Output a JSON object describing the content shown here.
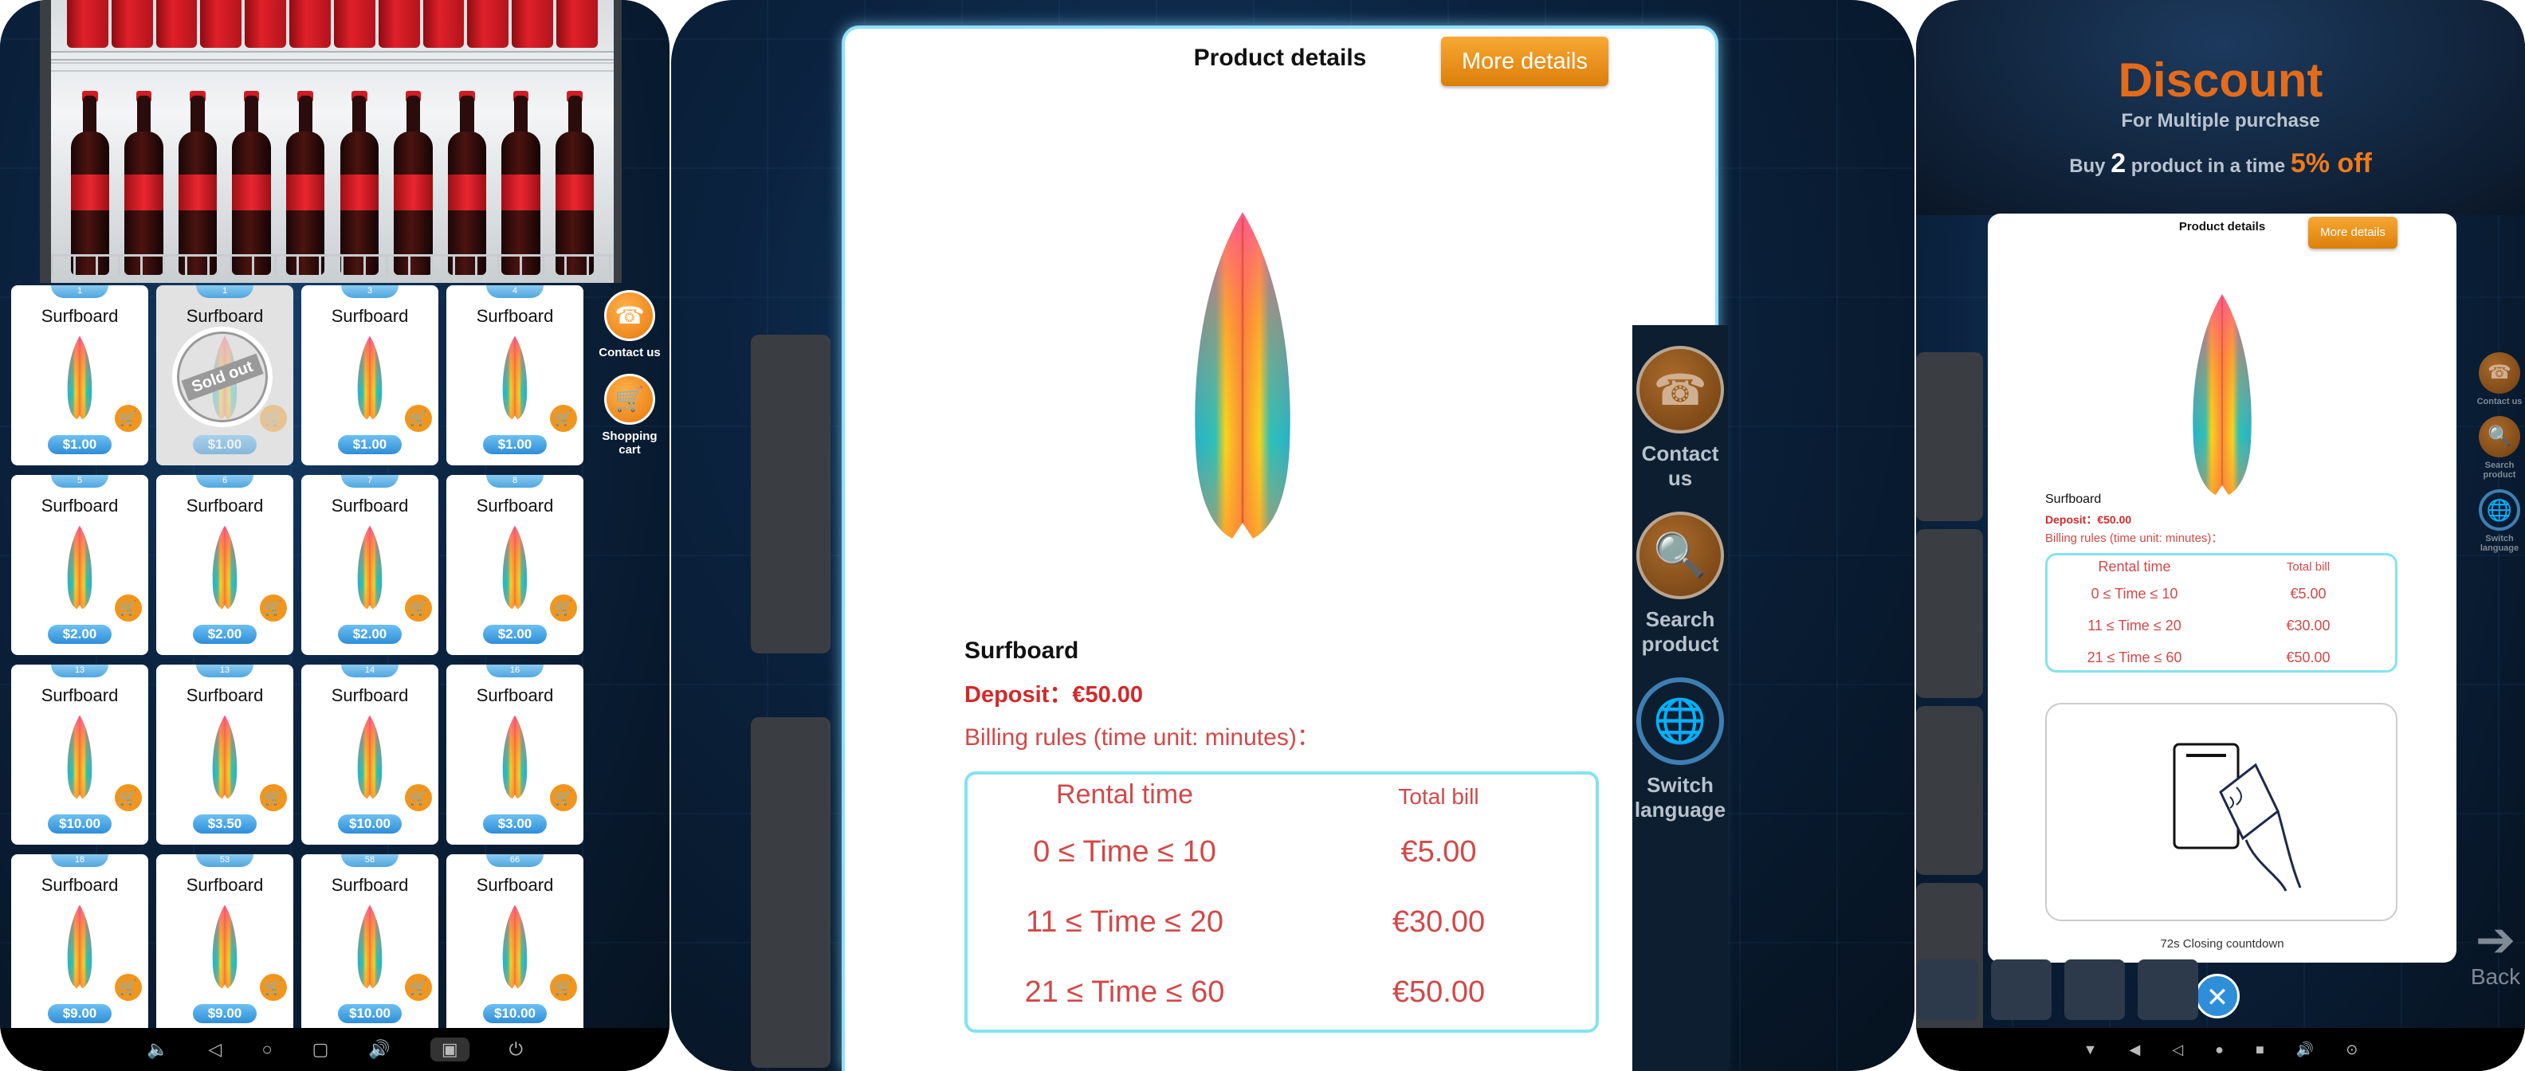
{
  "panel1": {
    "products": [
      {
        "num": "1",
        "name": "Surfboard",
        "price": "$1.00"
      },
      {
        "num": "1",
        "name": "Surfboard",
        "price": "$1.00",
        "sold": "Sold out"
      },
      {
        "num": "3",
        "name": "Surfboard",
        "price": "$1.00"
      },
      {
        "num": "4",
        "name": "Surfboard",
        "price": "$1.00"
      },
      {
        "num": "5",
        "name": "Surfboard",
        "price": "$2.00"
      },
      {
        "num": "6",
        "name": "Surfboard",
        "price": "$2.00"
      },
      {
        "num": "7",
        "name": "Surfboard",
        "price": "$2.00"
      },
      {
        "num": "8",
        "name": "Surfboard",
        "price": "$2.00"
      },
      {
        "num": "13",
        "name": "Surfboard",
        "price": "$10.00"
      },
      {
        "num": "13",
        "name": "Surfboard",
        "price": "$3.50"
      },
      {
        "num": "14",
        "name": "Surfboard",
        "price": "$10.00"
      },
      {
        "num": "16",
        "name": "Surfboard",
        "price": "$3.00"
      },
      {
        "num": "18",
        "name": "Surfboard",
        "price": "$9.00"
      },
      {
        "num": "53",
        "name": "Surfboard",
        "price": "$9.00"
      },
      {
        "num": "58",
        "name": "Surfboard",
        "price": "$10.00"
      },
      {
        "num": "66",
        "name": "Surfboard",
        "price": "$10.00"
      }
    ],
    "side": {
      "contact": "Contact us",
      "cart": "Shopping cart"
    }
  },
  "panel2": {
    "title": "Product details",
    "more": "More details",
    "product": "Surfboard",
    "deposit": "Deposit：€50.00",
    "rules": "Billing rules (time unit: minutes)：",
    "table": {
      "h1": "Rental time",
      "h2": "Total bill",
      "rows": [
        {
          "t": "0 ≤ Time ≤ 10",
          "b": "€5.00"
        },
        {
          "t": "11 ≤ Time ≤ 20",
          "b": "€30.00"
        },
        {
          "t": "21 ≤ Time ≤ 60",
          "b": "€50.00"
        }
      ]
    },
    "side": {
      "contact": "Contact us",
      "search": "Search product",
      "lang": "Switch language"
    }
  },
  "panel3": {
    "discount": "Discount",
    "sub": "For Multiple purchase",
    "buy_pre": "Buy ",
    "buy_num": "2",
    "buy_mid": " product in a time ",
    "buy_pct": "5% off",
    "title": "Product details",
    "more": "More details",
    "product": "Surfboard",
    "deposit": "Deposit：€50.00",
    "rules": "Billing rules (time unit: minutes)：",
    "table": {
      "h1": "Rental time",
      "h2": "Total bill",
      "rows": [
        {
          "t": "0 ≤ Time ≤ 10",
          "b": "€5.00"
        },
        {
          "t": "11 ≤ Time ≤ 20",
          "b": "€30.00"
        },
        {
          "t": "21 ≤ Time ≤ 60",
          "b": "€50.00"
        }
      ]
    },
    "countdown": "72s Closing countdown",
    "back": "Back",
    "side": {
      "contact": "Contact us",
      "search": "Search product",
      "lang": "Switch language"
    }
  },
  "colors": {
    "accent": "#f0961e",
    "blue": "#2f8ed8",
    "red": "#d12a2a",
    "cyan": "#82e3f0"
  }
}
